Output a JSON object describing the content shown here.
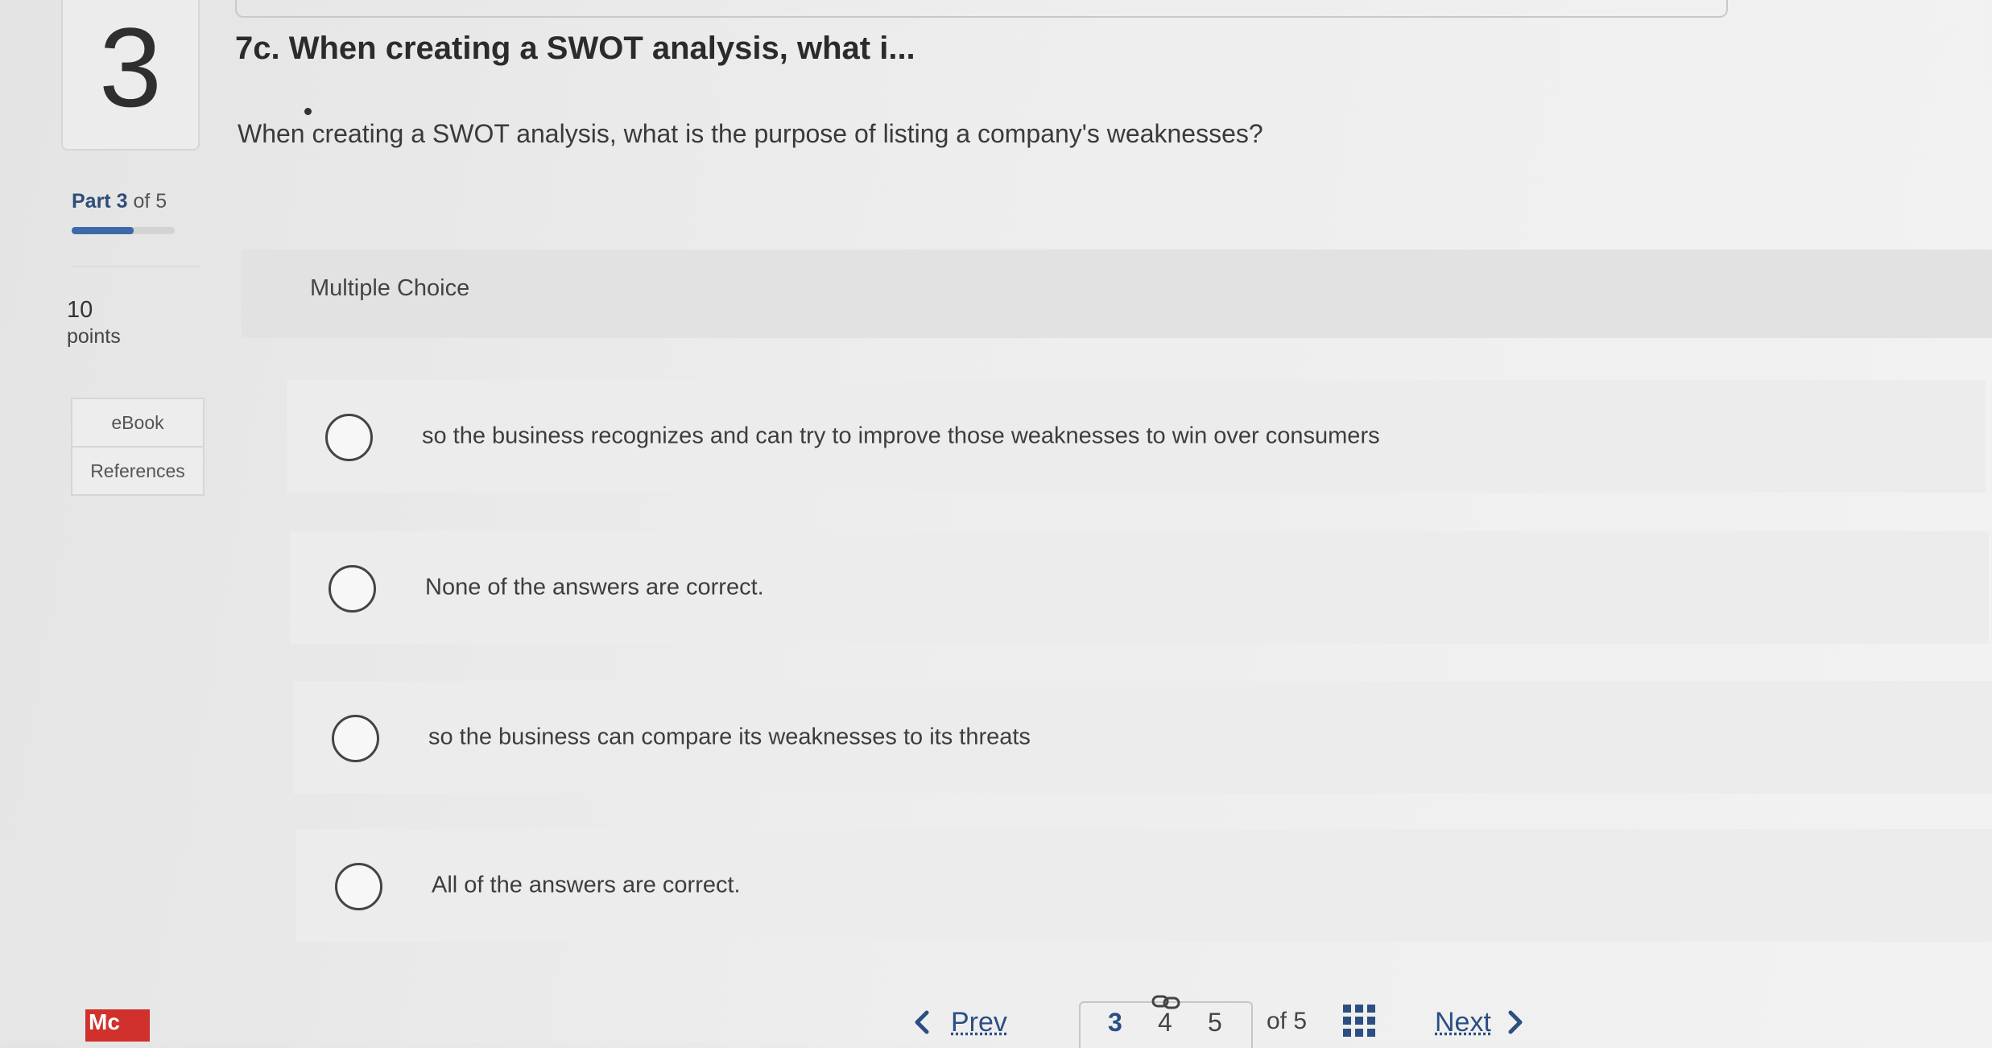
{
  "question": {
    "number": "3",
    "title": "7c. When creating a SWOT analysis, what i...",
    "text": "When creating a SWOT analysis, what is the purpose of listing a company's weaknesses?"
  },
  "part": {
    "label": "Part",
    "current": "3",
    "of_text": "of 5",
    "progress": 0.6
  },
  "points": {
    "value": "10",
    "label": "points"
  },
  "side_tabs": [
    "eBook",
    "References"
  ],
  "question_type": "Multiple Choice",
  "choices": [
    "so the business recognizes and can try to improve those weaknesses to win over consumers",
    "None of the answers are correct.",
    "so the business can compare its weaknesses to its threats",
    "All of the answers are correct."
  ],
  "footer": {
    "logo": "Mc",
    "prev_label": "Prev",
    "pages": [
      "3",
      "4",
      "5"
    ],
    "current_page": "3",
    "of_total": "of 5",
    "next_label": "Next"
  },
  "colors": {
    "accent": "#2b4f82",
    "progress": "#3c6aa8",
    "logo": "#d0312d"
  },
  "icons": [
    "chevron-left-icon",
    "link-icon",
    "grid-icon",
    "chevron-right-icon"
  ]
}
